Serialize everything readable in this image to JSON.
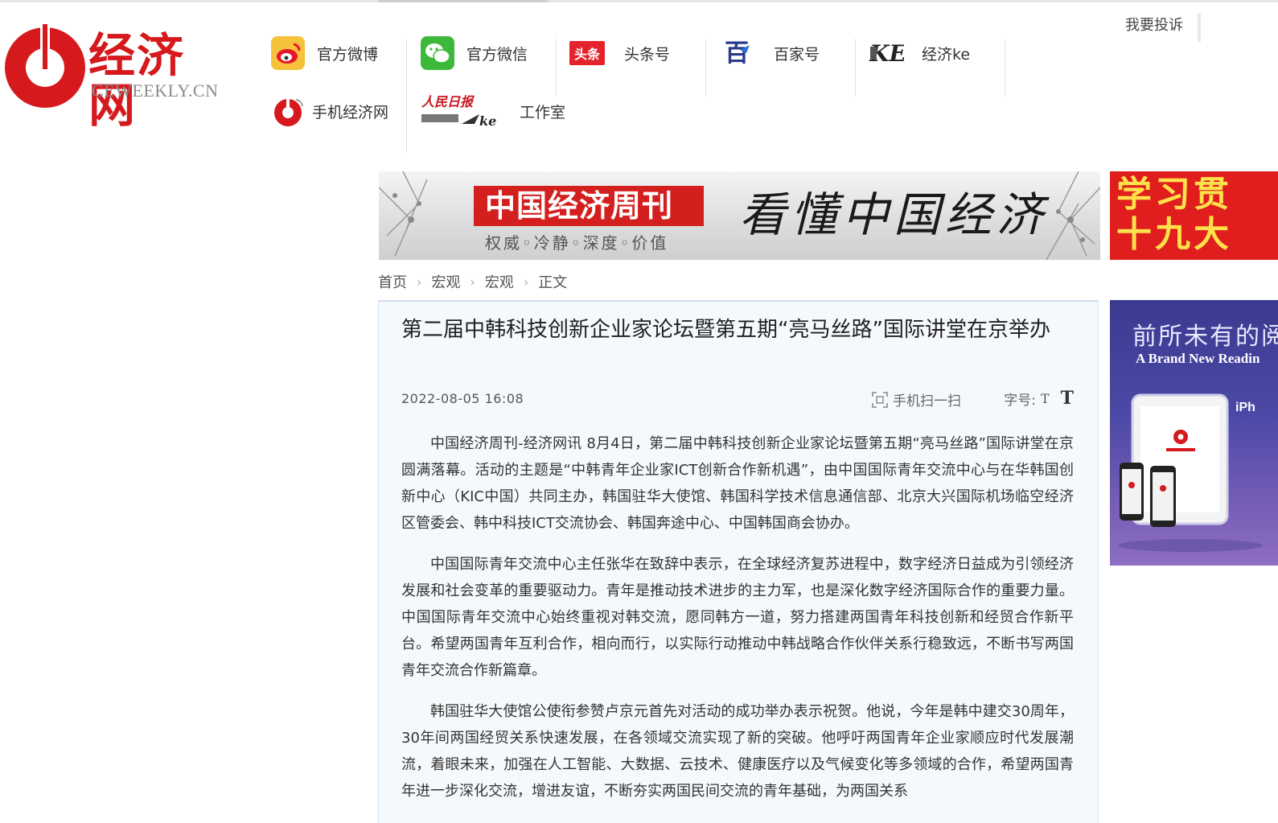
{
  "header": {
    "logo_name": "经济网",
    "logo_domain": "CEWEEKLY.CN",
    "complain_link": "我要投诉"
  },
  "social": [
    {
      "label": "官方微博",
      "icon": "weibo-icon"
    },
    {
      "label": "官方微信",
      "icon": "wechat-icon"
    },
    {
      "label": "头条号",
      "icon": "toutiao-icon",
      "icon_text": "头条"
    },
    {
      "label": "百家号",
      "icon": "baijia-icon",
      "icon_text": "百"
    },
    {
      "label": "经济ke",
      "icon": "jingjike-icon",
      "icon_text": "KE"
    },
    {
      "label": "手机经济网",
      "icon": "mobile-ceweekly-icon"
    },
    {
      "label": "工作室",
      "icon": "peoples-daily-studio-icon",
      "icon_text": "人民日报"
    }
  ],
  "banner": {
    "masthead": "中国经济周刊",
    "tagline": "权威◦冷静◦深度◦价值",
    "slogan": "看懂中国经济"
  },
  "banner_right": {
    "line1": "学习贯",
    "line2": "十九大"
  },
  "breadcrumb": [
    "首页",
    "宏观",
    "宏观",
    "正文"
  ],
  "article": {
    "title": "第二届中韩科技创新企业家论坛暨第五期“亮马丝路”国际讲堂在京举办",
    "date": "2022-08-05 16:08",
    "scan_label": "手机扫一扫",
    "font_size_label": "字号:",
    "font_small": "T",
    "font_big": "T",
    "paragraphs": [
      "中国经济周刊-经济网讯 8月4日，第二届中韩科技创新企业家论坛暨第五期“亮马丝路”国际讲堂在京圆满落幕。活动的主题是“中韩青年企业家ICT创新合作新机遇”，由中国国际青年交流中心与在华韩国创新中心（KIC中国）共同主办，韩国驻华大使馆、韩国科学技术信息通信部、北京大兴国际机场临空经济区管委会、韩中科技ICT交流协会、韩国奔途中心、中国韩国商会协办。",
      "中国国际青年交流中心主任张华在致辞中表示，在全球经济复苏进程中，数字经济日益成为引领经济发展和社会变革的重要驱动力。青年是推动技术进步的主力军，也是深化数字经济国际合作的重要力量。中国国际青年交流中心始终重视对韩交流，愿同韩方一道，努力搭建两国青年科技创新和经贸合作新平台。希望两国青年互利合作，相向而行，以实际行动推动中韩战略合作伙伴关系行稳致远，不断书写两国青年交流合作新篇章。",
      "韩国驻华大使馆公使衔参赞卢京元首先对活动的成功举办表示祝贺。他说，今年是韩中建交30周年，30年间两国经贸关系快速发展，在各领域交流实现了新的突破。他呼吁两国青年企业家顺应时代发展潮流，着眼未来，加强在人工智能、大数据、云技术、健康医疗以及气候变化等多领域的合作，希望两国青年进一步深化交流，增进友谊，不断夯实两国民间交流的青年基础，为两国关系"
    ]
  },
  "ad": {
    "headline": "前所未有的阅",
    "subline": "A Brand New Readin",
    "device": "iPh"
  }
}
